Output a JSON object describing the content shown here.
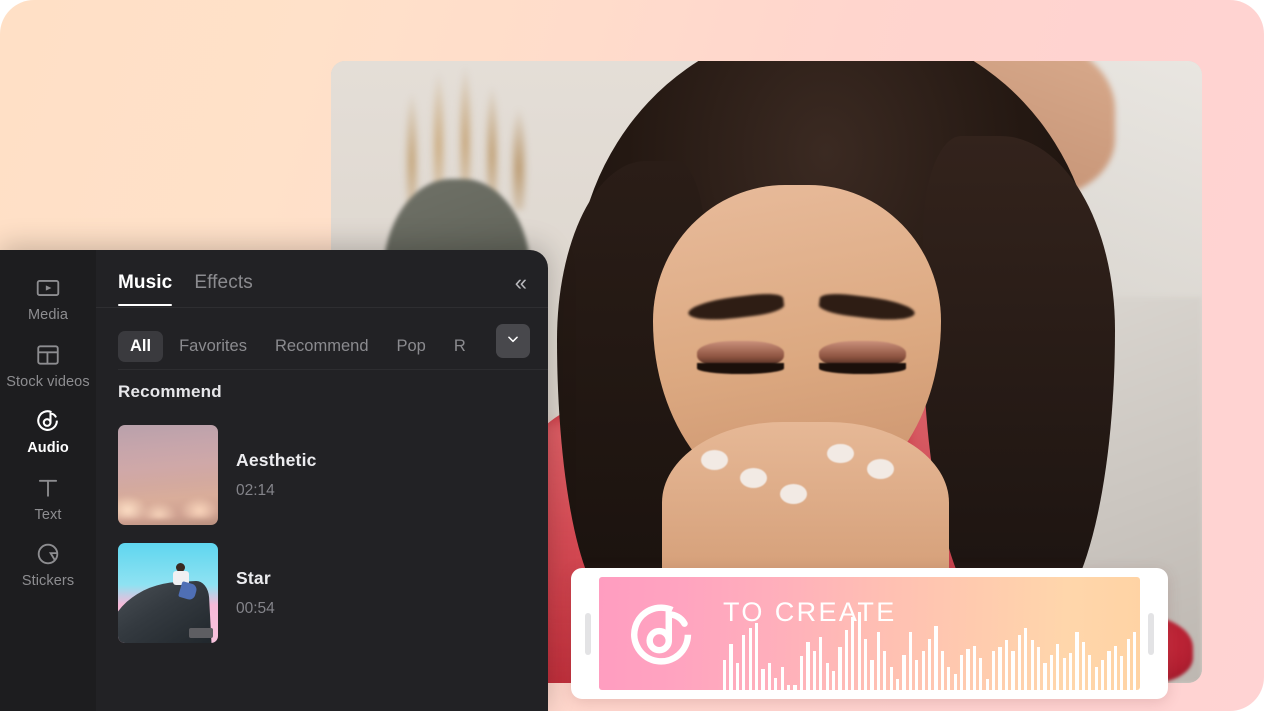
{
  "app": {
    "background_gradient_from": "#ffe0c6",
    "background_gradient_to": "#ffd3d3"
  },
  "sidebar": {
    "items": [
      {
        "label": "Media",
        "icon": "media-icon",
        "active": false
      },
      {
        "label": "Stock videos",
        "icon": "stock-videos-icon",
        "active": false
      },
      {
        "label": "Audio",
        "icon": "audio-icon",
        "active": true
      },
      {
        "label": "Text",
        "icon": "text-icon",
        "active": false
      },
      {
        "label": "Stickers",
        "icon": "stickers-icon",
        "active": false
      }
    ]
  },
  "panel": {
    "tabs": [
      {
        "label": "Music",
        "active": true
      },
      {
        "label": "Effects",
        "active": false
      }
    ],
    "collapse_icon": "chevron-double-left-icon",
    "filters": [
      {
        "label": "All",
        "active": true
      },
      {
        "label": "Favorites",
        "active": false
      },
      {
        "label": "Recommend",
        "active": false
      },
      {
        "label": "Pop",
        "active": false
      },
      {
        "label": "R",
        "active": false
      }
    ],
    "more_filters_icon": "chevron-down-icon",
    "section_title": "Recommend",
    "tracks": [
      {
        "name": "Aesthetic",
        "duration": "02:14",
        "thumb": "sunset-clouds-thumbnail"
      },
      {
        "name": "Star",
        "duration": "00:54",
        "thumb": "person-on-cliff-thumbnail"
      }
    ]
  },
  "clip": {
    "title": "TO CREATE",
    "logo_icon": "audio-note-circle-icon",
    "left_handle_icon": "trim-handle-left",
    "right_handle_icon": "trim-handle-right",
    "gradient_from": "#ff9dc0",
    "gradient_to": "#ffd3a4",
    "waveform": [
      34,
      52,
      30,
      62,
      70,
      76,
      24,
      30,
      14,
      26,
      4,
      4,
      38,
      54,
      44,
      60,
      30,
      22,
      48,
      68,
      82,
      88,
      58,
      34,
      66,
      44,
      26,
      12,
      40,
      66,
      34,
      44,
      58,
      72,
      44,
      26,
      18,
      40,
      46,
      50,
      36,
      12,
      44,
      48,
      56,
      44,
      62,
      70,
      56,
      48,
      30,
      40,
      52,
      36,
      42,
      66,
      54,
      40,
      26,
      34,
      44,
      50,
      38,
      58,
      66
    ]
  }
}
